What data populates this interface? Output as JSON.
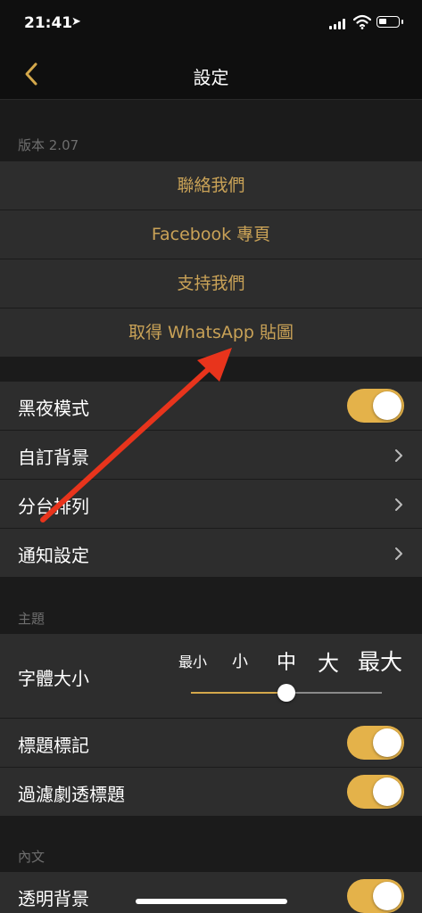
{
  "status_bar": {
    "time": "21:41",
    "location_icon": "location-arrow-icon",
    "signal_icon": "cellular-signal-icon",
    "wifi_icon": "wifi-icon",
    "battery_icon": "battery-icon",
    "battery_level": 0.3
  },
  "nav": {
    "title": "設定",
    "back_icon": "chevron-left-icon"
  },
  "version_section": {
    "header": "版本 2.07",
    "links": [
      "聯絡我們",
      "Facebook 專頁",
      "支持我們",
      "取得 WhatsApp 貼圖"
    ]
  },
  "general": {
    "dark_mode": {
      "label": "黑夜模式",
      "on": true
    },
    "custom_background": {
      "label": "自訂背景"
    },
    "channel_order": {
      "label": "分台排列"
    },
    "notification_settings": {
      "label": "通知設定"
    }
  },
  "theme_section": {
    "header": "主題",
    "font_size": {
      "label": "字體大小",
      "options": [
        "最小",
        "小",
        "中",
        "大",
        "最大"
      ],
      "selected": "中",
      "selected_index": 2
    },
    "title_mark": {
      "label": "標題標記",
      "on": true
    },
    "filter_spoiler": {
      "label": "過濾劇透標題",
      "on": true
    }
  },
  "body_section": {
    "header": "內文",
    "transparent_bg": {
      "label": "透明背景",
      "on": true
    }
  },
  "colors": {
    "accent": "#c9a257",
    "toggle_on": "#e4b24a",
    "row_bg": "#2d2d2d",
    "page_bg": "#1b1b1b",
    "annotation_arrow": "#e8341c"
  }
}
